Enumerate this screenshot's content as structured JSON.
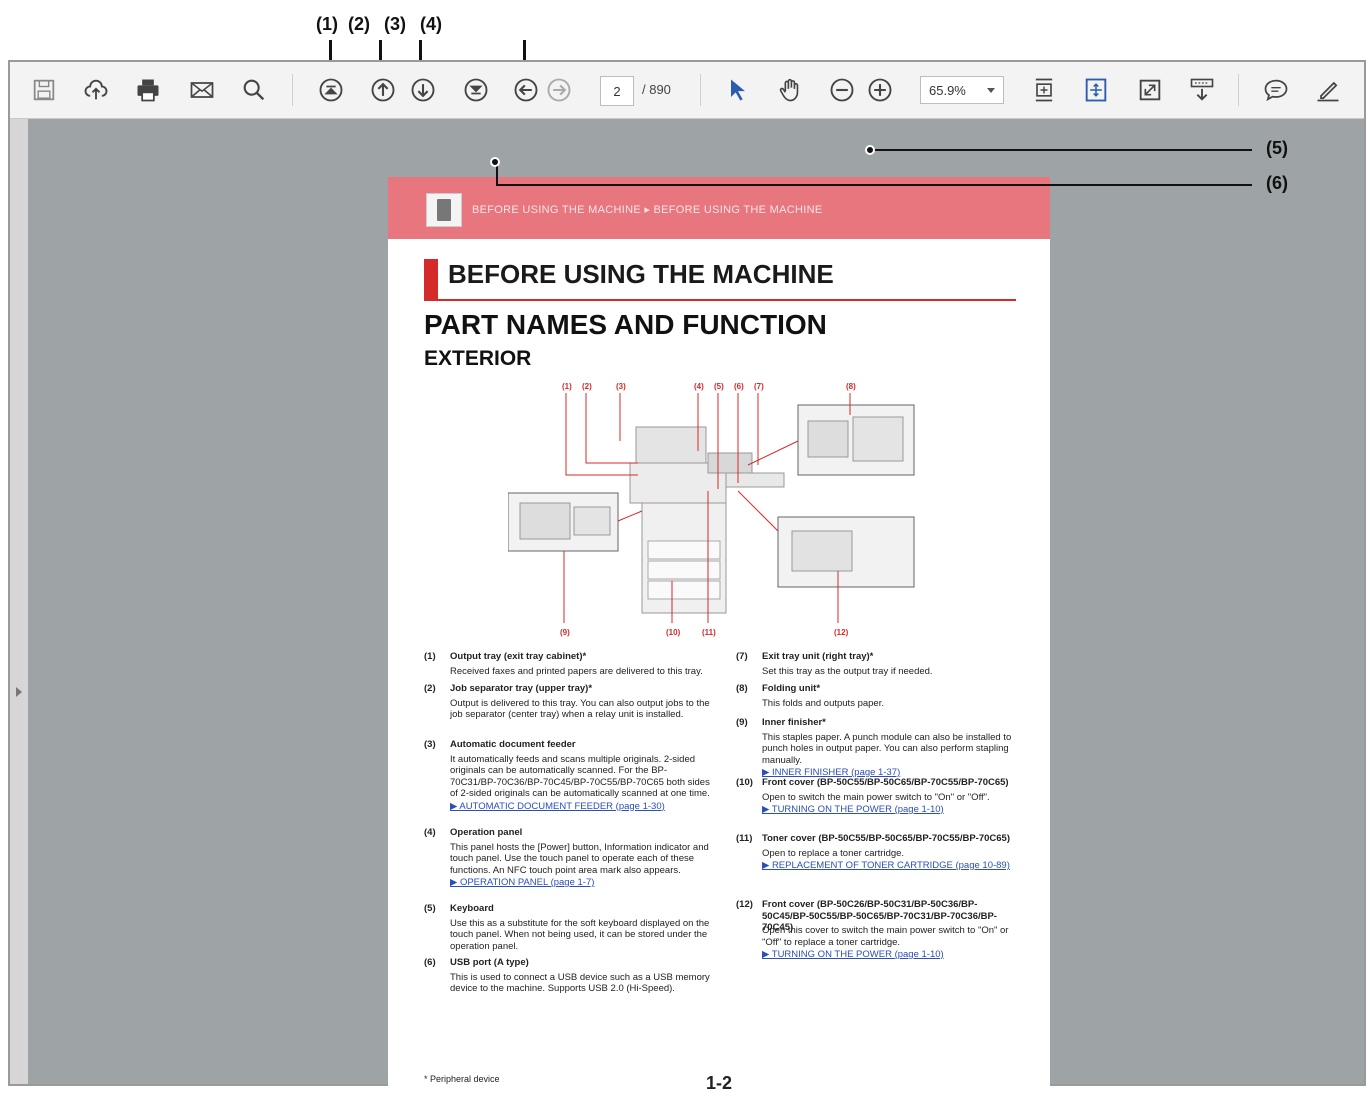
{
  "callouts_top": [
    "(1)",
    "(2)",
    "(3)",
    "(4)"
  ],
  "toolbar": {
    "page_current": "2",
    "page_total": "/ 890",
    "zoom": "65.9%",
    "icons": [
      "save-icon",
      "upload-icon",
      "print-icon",
      "email-icon",
      "search-icon",
      "first-page-icon",
      "prev-page-icon",
      "next-page-icon",
      "last-page-icon",
      "back-icon",
      "forward-icon",
      "select-tool-icon",
      "hand-tool-icon",
      "zoom-out-icon",
      "zoom-in-icon",
      "fit-page-icon",
      "page-view-icon",
      "fullscreen-icon",
      "read-mode-icon",
      "comment-icon",
      "sign-icon"
    ]
  },
  "callouts_right": [
    "(5)",
    "(6)"
  ],
  "document": {
    "breadcrumb": "BEFORE USING THE MACHINE ▸ BEFORE USING THE MACHINE",
    "section_title": "BEFORE USING THE MACHINE",
    "heading": "PART NAMES AND FUNCTION",
    "subheading": "EXTERIOR",
    "diagram_labels": [
      "(1)",
      "(2)",
      "(3)",
      "(4)",
      "(5)",
      "(6)",
      "(7)",
      "(8)",
      "(9)",
      "(10)",
      "(11)",
      "(12)"
    ],
    "left_items": [
      {
        "num": "(1)",
        "title": "Output tray (exit tray cabinet)*",
        "body": "Received faxes and printed papers are delivered to this tray.",
        "link": ""
      },
      {
        "num": "(2)",
        "title": "Job separator tray (upper tray)*",
        "body": "Output is delivered to this tray. You can also output jobs to the job separator (center tray) when a relay unit is installed.",
        "link": ""
      },
      {
        "num": "(3)",
        "title": "Automatic document feeder",
        "body": "It automatically feeds and scans multiple originals. 2-sided originals can be automatically scanned. For the BP-70C31/BP-70C36/BP-70C45/BP-70C55/BP-70C65 both sides of 2-sided originals can be automatically scanned at one time.",
        "link": "AUTOMATIC DOCUMENT FEEDER (page 1-30)"
      },
      {
        "num": "(4)",
        "title": "Operation panel",
        "body": "This panel hosts the [Power] button, Information indicator and touch panel. Use the touch panel to operate each of these functions. An NFC touch point area mark also appears.",
        "link": "OPERATION PANEL (page 1-7)"
      },
      {
        "num": "(5)",
        "title": "Keyboard",
        "body": "Use this as a substitute for the soft keyboard displayed on the touch panel. When not being used, it can be stored under the operation panel.",
        "link": ""
      },
      {
        "num": "(6)",
        "title": "USB port (A type)",
        "body": "This is used to connect a USB device such as a USB memory device to the machine. Supports USB 2.0 (Hi-Speed).",
        "link": ""
      }
    ],
    "right_items": [
      {
        "num": "(7)",
        "title": "Exit tray unit (right tray)*",
        "body": "Set this tray as the output tray if needed.",
        "link": ""
      },
      {
        "num": "(8)",
        "title": "Folding unit*",
        "body": "This folds and outputs paper.",
        "link": ""
      },
      {
        "num": "(9)",
        "title": "Inner finisher*",
        "body": "This staples paper. A punch module can also be installed to punch holes in output paper. You can also perform stapling manually.",
        "link": "INNER FINISHER (page 1-37)"
      },
      {
        "num": "(10)",
        "title": "Front cover (BP-50C55/BP-50C65/BP-70C55/BP-70C65)",
        "body": "Open to switch the main power switch to \"On\" or \"Off\".",
        "link": "TURNING ON THE POWER (page 1-10)"
      },
      {
        "num": "(11)",
        "title": "Toner cover (BP-50C55/BP-50C65/BP-70C55/BP-70C65)",
        "body": "Open to replace a toner cartridge.",
        "link": "REPLACEMENT OF TONER CARTRIDGE (page 10-89)"
      },
      {
        "num": "(12)",
        "title": "Front cover (BP-50C26/BP-50C31/BP-50C36/BP-50C45/BP-50C55/BP-50C65/BP-70C31/BP-70C36/BP-70C45)",
        "body": "Open this cover to switch the main power switch to \"On\" or \"Off\" to replace a toner cartridge.",
        "link": "TURNING ON THE POWER (page 1-10)"
      }
    ],
    "footnote": "*   Peripheral device",
    "page_number": "1-2"
  },
  "colors": {
    "header_band": "#e8767f",
    "accent_red": "#d42a2a",
    "link_blue": "#2b4fb8",
    "viewer_bg": "#9ea3a6"
  }
}
